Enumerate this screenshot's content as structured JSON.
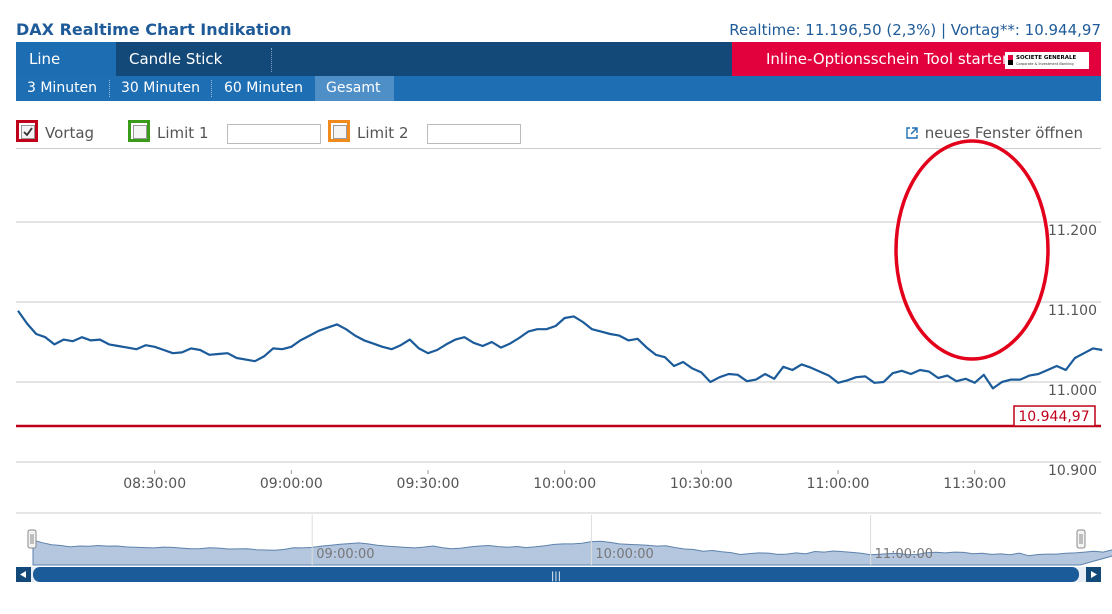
{
  "header": {
    "title": "DAX Realtime Chart Indikation",
    "realtime": "Realtime: 11.196,50 (2,3%) | Vortag**: 10.944,97"
  },
  "tabs": [
    {
      "label": "Line Chart",
      "active": true
    },
    {
      "label": "Candle Stick Chart",
      "active": false
    }
  ],
  "promo": {
    "label": "Inline-Optionsschein Tool starten",
    "logo": "SOCIETE GENERALE",
    "logo_sub": "Corporate & Investment Banking"
  },
  "intervals": [
    {
      "label": "3 Minuten",
      "active": false
    },
    {
      "label": "30 Minuten",
      "active": false
    },
    {
      "label": "60 Minuten",
      "active": false
    },
    {
      "label": "Gesamt",
      "active": true
    }
  ],
  "options": {
    "vortag": {
      "label": "Vortag",
      "checked": true,
      "color": "#c0001a"
    },
    "limit1": {
      "label": "Limit 1",
      "checked": false,
      "color": "#3a9a1a",
      "value": ""
    },
    "limit2": {
      "label": "Limit 2",
      "checked": false,
      "color": "#f08a1c",
      "value": ""
    },
    "new_window": "neues Fenster öffnen"
  },
  "chart_data": {
    "type": "line",
    "ylim": [
      10900,
      11220
    ],
    "yticks": [
      {
        "value": 11200,
        "label": "11.200"
      },
      {
        "value": 11100,
        "label": "11.100"
      },
      {
        "value": 11000,
        "label": "11.000"
      },
      {
        "value": 10900,
        "label": "10.900"
      }
    ],
    "xlim": [
      "08:00",
      "11:45"
    ],
    "xticks": [
      "08:30:00",
      "09:00:00",
      "09:30:00",
      "10:00:00",
      "10:30:00",
      "11:00:00",
      "11:30:00"
    ],
    "reference_line": {
      "value": 10944.97,
      "label": "10.944,97",
      "color": "#c0001a"
    },
    "series": [
      {
        "color": "#1b5b9a",
        "points": [
          [
            "08:00",
            11089
          ],
          [
            "08:02",
            11073
          ],
          [
            "08:04",
            11060
          ],
          [
            "08:06",
            11056
          ],
          [
            "08:08",
            11047
          ],
          [
            "08:10",
            11053
          ],
          [
            "08:12",
            11051
          ],
          [
            "08:14",
            11056
          ],
          [
            "08:16",
            11052
          ],
          [
            "08:18",
            11053
          ],
          [
            "08:20",
            11047
          ],
          [
            "08:22",
            11045
          ],
          [
            "08:24",
            11043
          ],
          [
            "08:26",
            11041
          ],
          [
            "08:28",
            11046
          ],
          [
            "08:30",
            11044
          ],
          [
            "08:32",
            11040
          ],
          [
            "08:34",
            11036
          ],
          [
            "08:36",
            11037
          ],
          [
            "08:38",
            11042
          ],
          [
            "08:40",
            11040
          ],
          [
            "08:42",
            11034
          ],
          [
            "08:44",
            11035
          ],
          [
            "08:46",
            11036
          ],
          [
            "08:48",
            11030
          ],
          [
            "08:50",
            11028
          ],
          [
            "08:52",
            11026
          ],
          [
            "08:54",
            11032
          ],
          [
            "08:56",
            11042
          ],
          [
            "08:58",
            11041
          ],
          [
            "09:00",
            11044
          ],
          [
            "09:02",
            11052
          ],
          [
            "09:04",
            11058
          ],
          [
            "09:06",
            11064
          ],
          [
            "09:08",
            11068
          ],
          [
            "09:10",
            11072
          ],
          [
            "09:12",
            11066
          ],
          [
            "09:14",
            11058
          ],
          [
            "09:16",
            11052
          ],
          [
            "09:18",
            11048
          ],
          [
            "09:20",
            11044
          ],
          [
            "09:22",
            11041
          ],
          [
            "09:24",
            11046
          ],
          [
            "09:26",
            11053
          ],
          [
            "09:28",
            11042
          ],
          [
            "09:30",
            11036
          ],
          [
            "09:32",
            11040
          ],
          [
            "09:34",
            11047
          ],
          [
            "09:36",
            11053
          ],
          [
            "09:38",
            11056
          ],
          [
            "09:40",
            11049
          ],
          [
            "09:42",
            11045
          ],
          [
            "09:44",
            11050
          ],
          [
            "09:46",
            11043
          ],
          [
            "09:48",
            11048
          ],
          [
            "09:50",
            11055
          ],
          [
            "09:52",
            11063
          ],
          [
            "09:54",
            11066
          ],
          [
            "09:56",
            11066
          ],
          [
            "09:58",
            11070
          ],
          [
            "10:00",
            11080
          ],
          [
            "10:02",
            11082
          ],
          [
            "10:04",
            11075
          ],
          [
            "10:06",
            11066
          ],
          [
            "10:08",
            11063
          ],
          [
            "10:10",
            11060
          ],
          [
            "10:12",
            11058
          ],
          [
            "10:14",
            11052
          ],
          [
            "10:16",
            11054
          ],
          [
            "10:18",
            11043
          ],
          [
            "10:20",
            11034
          ],
          [
            "10:22",
            11031
          ],
          [
            "10:24",
            11020
          ],
          [
            "10:26",
            11025
          ],
          [
            "10:28",
            11017
          ],
          [
            "10:30",
            11012
          ],
          [
            "10:32",
            11000
          ],
          [
            "10:34",
            11006
          ],
          [
            "10:36",
            11010
          ],
          [
            "10:38",
            11009
          ],
          [
            "10:40",
            11001
          ],
          [
            "10:42",
            11003
          ],
          [
            "10:44",
            11010
          ],
          [
            "10:46",
            11004
          ],
          [
            "10:48",
            11019
          ],
          [
            "10:50",
            11015
          ],
          [
            "10:52",
            11022
          ],
          [
            "10:54",
            11018
          ],
          [
            "10:56",
            11013
          ],
          [
            "10:58",
            11008
          ],
          [
            "11:00",
            10999
          ],
          [
            "11:02",
            11002
          ],
          [
            "11:04",
            11006
          ],
          [
            "11:06",
            11007
          ],
          [
            "11:08",
            10999
          ],
          [
            "11:10",
            11000
          ],
          [
            "11:12",
            11011
          ],
          [
            "11:14",
            11014
          ],
          [
            "11:16",
            11010
          ],
          [
            "11:18",
            11015
          ],
          [
            "11:20",
            11013
          ],
          [
            "11:22",
            11005
          ],
          [
            "11:24",
            11008
          ],
          [
            "11:26",
            11001
          ],
          [
            "11:28",
            11004
          ],
          [
            "11:30",
            10999
          ],
          [
            "11:32",
            11009
          ],
          [
            "11:34",
            10992
          ],
          [
            "11:36",
            11000
          ],
          [
            "11:38",
            11003
          ],
          [
            "11:40",
            11003
          ],
          [
            "11:42",
            11008
          ],
          [
            "11:44",
            11010
          ],
          [
            "11:46",
            11015
          ],
          [
            "11:48",
            11020
          ],
          [
            "11:50",
            11015
          ],
          [
            "11:52",
            11030
          ],
          [
            "11:54",
            11036
          ],
          [
            "11:56",
            11042
          ],
          [
            "11:58",
            11040
          ]
        ]
      }
    ]
  },
  "navigator": {
    "labels": [
      "09:00:00",
      "10:00:00",
      "11:00:00"
    ],
    "scroll_icon": "|||"
  }
}
